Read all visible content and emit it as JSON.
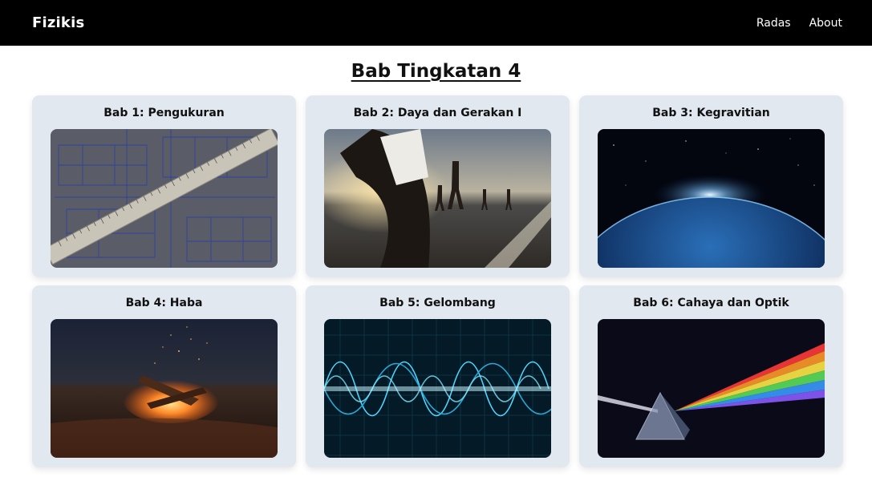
{
  "navbar": {
    "brand": "Fizikis",
    "links": [
      {
        "label": "Radas"
      },
      {
        "label": "About"
      }
    ]
  },
  "main": {
    "title": "Bab Tingkatan 4",
    "chapters": [
      {
        "title": "Bab 1: Pengukuran",
        "image": "ruler-blueprint-image"
      },
      {
        "title": "Bab 2: Daya dan Gerakan I",
        "image": "runners-road-image"
      },
      {
        "title": "Bab 3: Kegravitian",
        "image": "earth-space-image"
      },
      {
        "title": "Bab 4: Haba",
        "image": "campfire-beach-image"
      },
      {
        "title": "Bab 5: Gelombang",
        "image": "waveforms-image"
      },
      {
        "title": "Bab 6: Cahaya dan Optik",
        "image": "prism-spectrum-image"
      }
    ]
  }
}
